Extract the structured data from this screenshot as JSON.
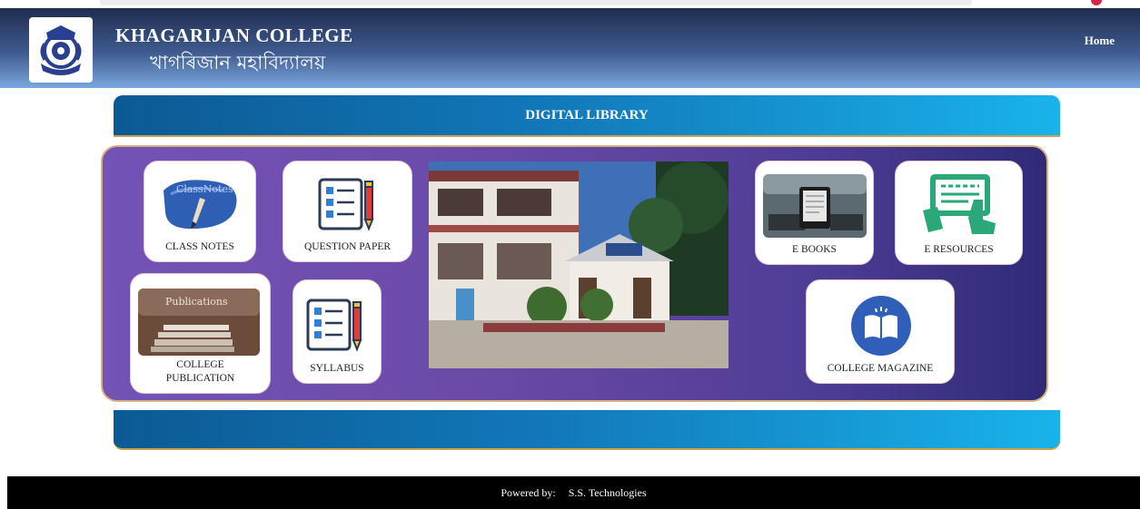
{
  "header": {
    "title_en": "KHAGARIJAN COLLEGE",
    "title_bn": "খাগৰিজান মহাবিদ্যালয়",
    "nav_home": "Home"
  },
  "banner": {
    "title": "DIGITAL LIBRARY"
  },
  "tiles": {
    "class_notes": {
      "label": "CLASS NOTES",
      "image_text": "ClassNotes"
    },
    "question_paper": {
      "label": "QUESTION PAPER"
    },
    "college_publication": {
      "label_line1": "COLLEGE",
      "label_line2": "PUBLICATION",
      "image_text": "Publications"
    },
    "syllabus": {
      "label": "SYLLABUS"
    },
    "e_books": {
      "label": "E BOOKS"
    },
    "e_resources": {
      "label": "E RESOURCES"
    },
    "college_magazine": {
      "label": "COLLEGE MAGAZINE"
    }
  },
  "footer": {
    "powered_by": "Powered by:",
    "company": "S.S. Technologies"
  },
  "colors": {
    "header_dark": "#1f2d4f",
    "banner_blue": "#1277b8",
    "panel_purple": "#6b4aa7",
    "accent_gold": "#c8a24c"
  }
}
